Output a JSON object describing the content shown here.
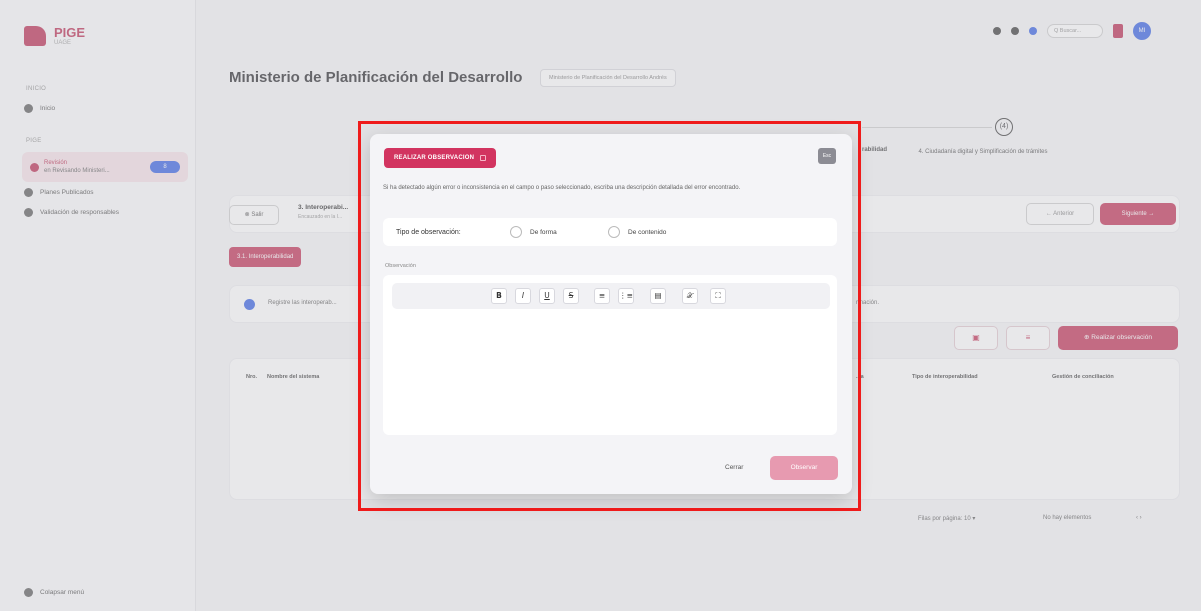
{
  "sidebar": {
    "brand": "PIGE",
    "brand_sub": "UAGE",
    "section_inicio": "INICIO",
    "inicio": "Inicio",
    "section_pige": "PIGE",
    "active_item_title": "Revisión",
    "active_item_sub": "en Revisando Ministeri...",
    "active_item_badge": "8",
    "planes": "Planes Publicados",
    "validacion": "Validación de responsables",
    "collapse": "Colapsar menú"
  },
  "topbar": {
    "search_placeholder": "Q Buscar...",
    "avatar": "MI"
  },
  "page": {
    "title": "Ministerio de Planificación del Desarrollo",
    "tag": "Ministerio de Planificación del Desarrollo Andrés"
  },
  "steps": {
    "step3_label_tail": "rabilidad",
    "step4_number": "(4)",
    "step4_label": "4. Ciudadanía digital y Simplificación de trámites"
  },
  "toolbar": {
    "salir": "⊗ Salir",
    "section_title": "3. Interoperabi...",
    "section_sub": "Encauzado en la I...",
    "anterior": "← Anterior",
    "siguiente": "Siguiente →"
  },
  "chip_tab": "3.1. Interoperabilidad",
  "info": {
    "text_left": "Registre las interoperab...",
    "text_right": "rmación."
  },
  "actions": {
    "realizar": "⊕ Realizar observación"
  },
  "table": {
    "headers": [
      "Nro.",
      "Nombre del sistema",
      "...a",
      "Tipo de interoperabilidad",
      "Gestión de conciliación"
    ]
  },
  "pager": {
    "per_page": "Filas por página:  10  ▾",
    "empty": "No hay elementos",
    "nav": "‹   ›"
  },
  "modal": {
    "header_button": "REALIZAR OBSERVACION",
    "esc": "Esc",
    "description": "Si ha detectado algún error o inconsistencia en el campo o paso seleccionado, escriba una descripción detallada del error encontrado.",
    "type_label": "Tipo de observación:",
    "option_forma": "De forma",
    "option_contenido": "De contenido",
    "obs_label": "Observación",
    "toolbar": [
      "B",
      "I",
      "U",
      "S",
      "≡",
      "⋮≡",
      "▤",
      "𝒳",
      "⛶"
    ],
    "cancel": "Cerrar",
    "submit": "Observar"
  },
  "colors": {
    "brand": "#c0284f",
    "highlight_frame": "#ef1b1b",
    "primary_blue": "#2d5be3"
  }
}
